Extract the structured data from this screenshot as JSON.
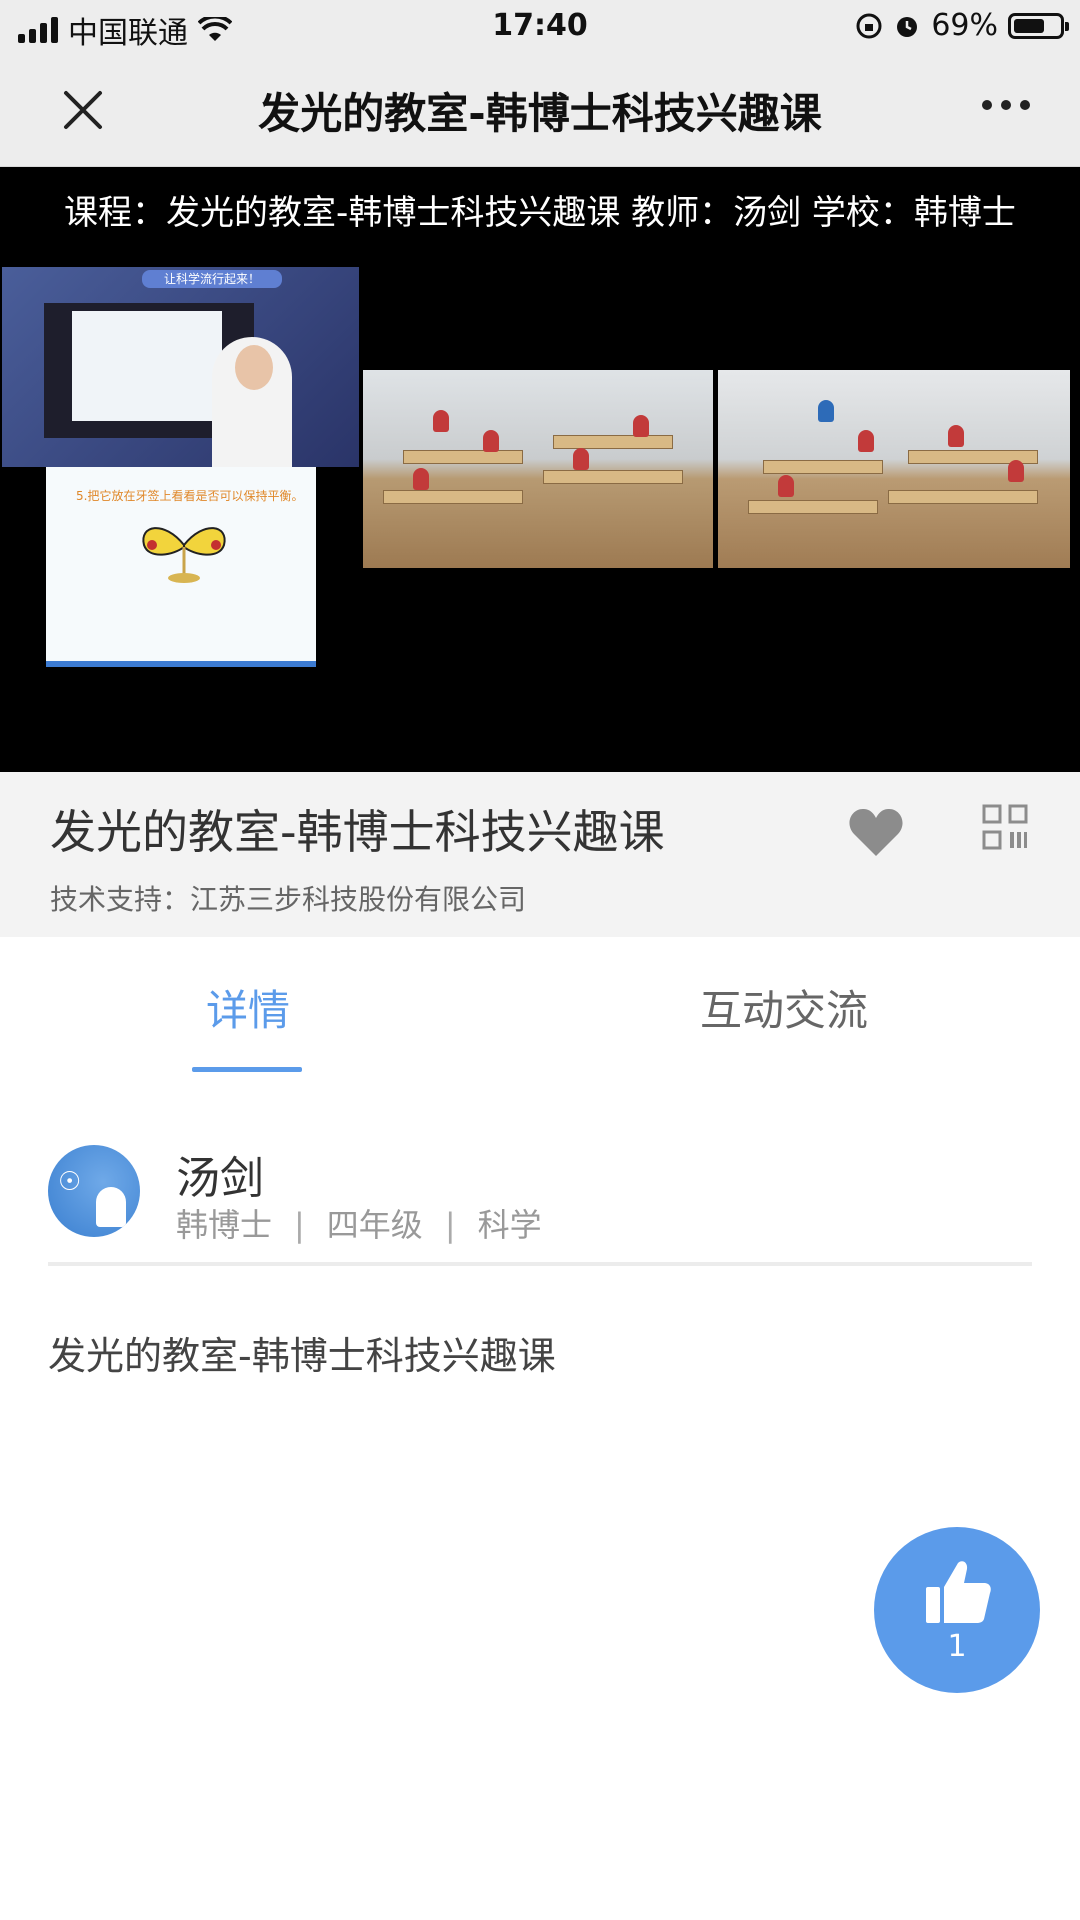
{
  "status_bar": {
    "carrier": "中国联通",
    "time": "17:40",
    "battery_percent": "69%",
    "battery_level": 0.69
  },
  "nav": {
    "title": "发光的教室-韩博士科技兴趣课"
  },
  "video": {
    "caption": "课程：发光的教室-韩博士科技兴趣课  教师：汤剑  学校：韩博士",
    "slide_banner": "让科学流行起来！",
    "slide_step": "5.把它放在牙签上看看是否可以保持平衡。"
  },
  "course": {
    "title": "发光的教室-韩博士科技兴趣课",
    "support": "技术支持：江苏三步科技股份有限公司"
  },
  "tabs": {
    "detail": "详情",
    "chat": "互动交流"
  },
  "teacher": {
    "name": "汤剑",
    "school": "韩博士",
    "grade": "四年级",
    "subject": "科学",
    "separator": "|"
  },
  "description": "发光的教室-韩博士科技兴趣课",
  "like": {
    "count": "1"
  },
  "colors": {
    "accent": "#5b9bea",
    "header_bg": "#ededed",
    "video_bg": "#000000"
  },
  "icons": [
    "signal-icon",
    "wifi-icon",
    "rotation-lock-icon",
    "alarm-icon",
    "battery-icon",
    "close-icon",
    "more-icon",
    "heart-icon",
    "qr-code-icon",
    "thumbs-up-icon"
  ]
}
